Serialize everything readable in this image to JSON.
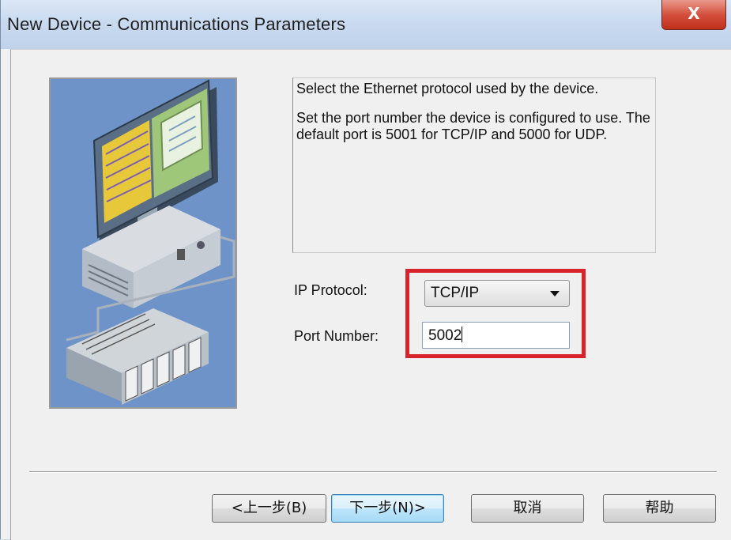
{
  "window": {
    "title": "New Device - Communications Parameters",
    "close_label": "X"
  },
  "description": {
    "line1": "Select the Ethernet protocol used by the device.",
    "line2": "Set the port number the device is configured to use. The default port is 5001 for TCP/IP and 5000 for UDP."
  },
  "form": {
    "protocol_label": "IP Protocol:",
    "protocol_value": "TCP/IP",
    "port_label": "Port Number:",
    "port_value": "5002"
  },
  "buttons": {
    "back": "<上一步(B)",
    "next": "下一步(N)>",
    "cancel": "取消",
    "help": "帮助"
  },
  "colors": {
    "highlight": "#d9232b",
    "image_background": "#6e93c8"
  }
}
